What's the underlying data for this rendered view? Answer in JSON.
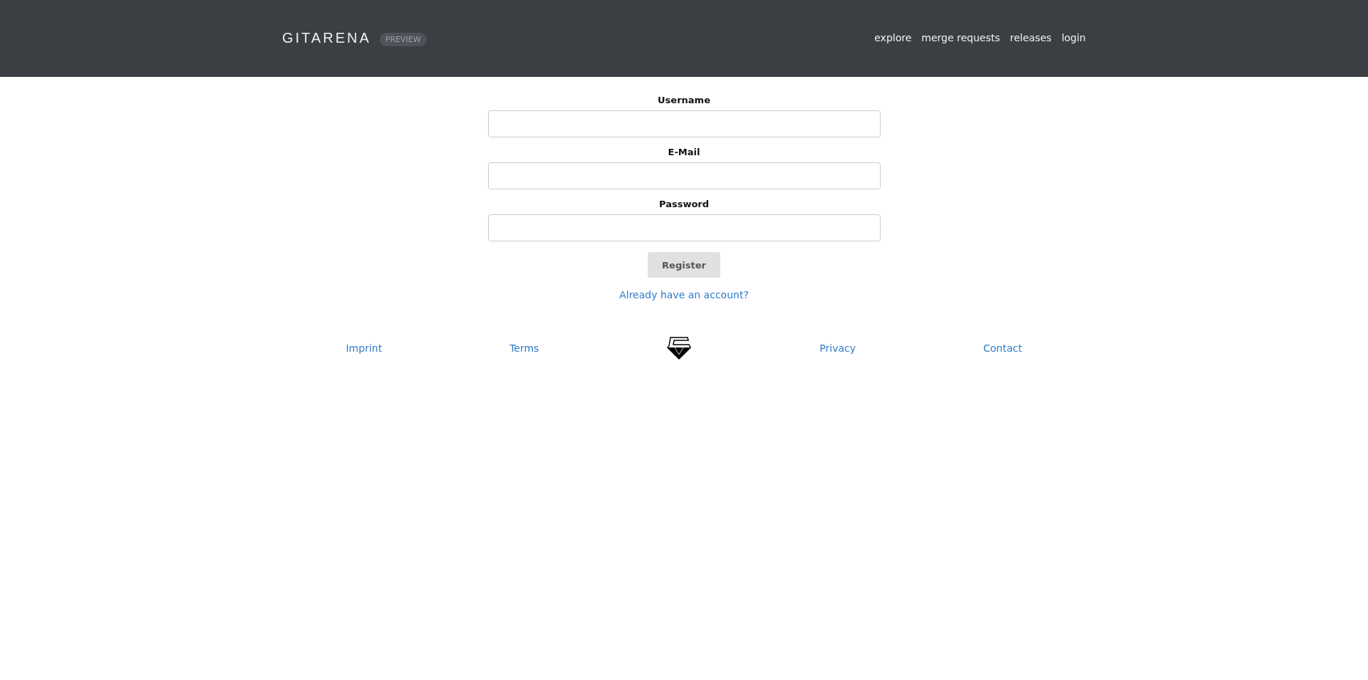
{
  "header": {
    "brand": "GITARENA",
    "badge": "PREVIEW",
    "nav": [
      "explore",
      "merge requests",
      "releases",
      "login"
    ]
  },
  "form": {
    "fields": [
      {
        "label": "Username"
      },
      {
        "label": "E-Mail"
      },
      {
        "label": "Password"
      }
    ],
    "submit": "Register",
    "link": "Already have an account?"
  },
  "footer": {
    "left": [
      "Imprint",
      "Terms"
    ],
    "right": [
      "Privacy",
      "Contact"
    ]
  }
}
